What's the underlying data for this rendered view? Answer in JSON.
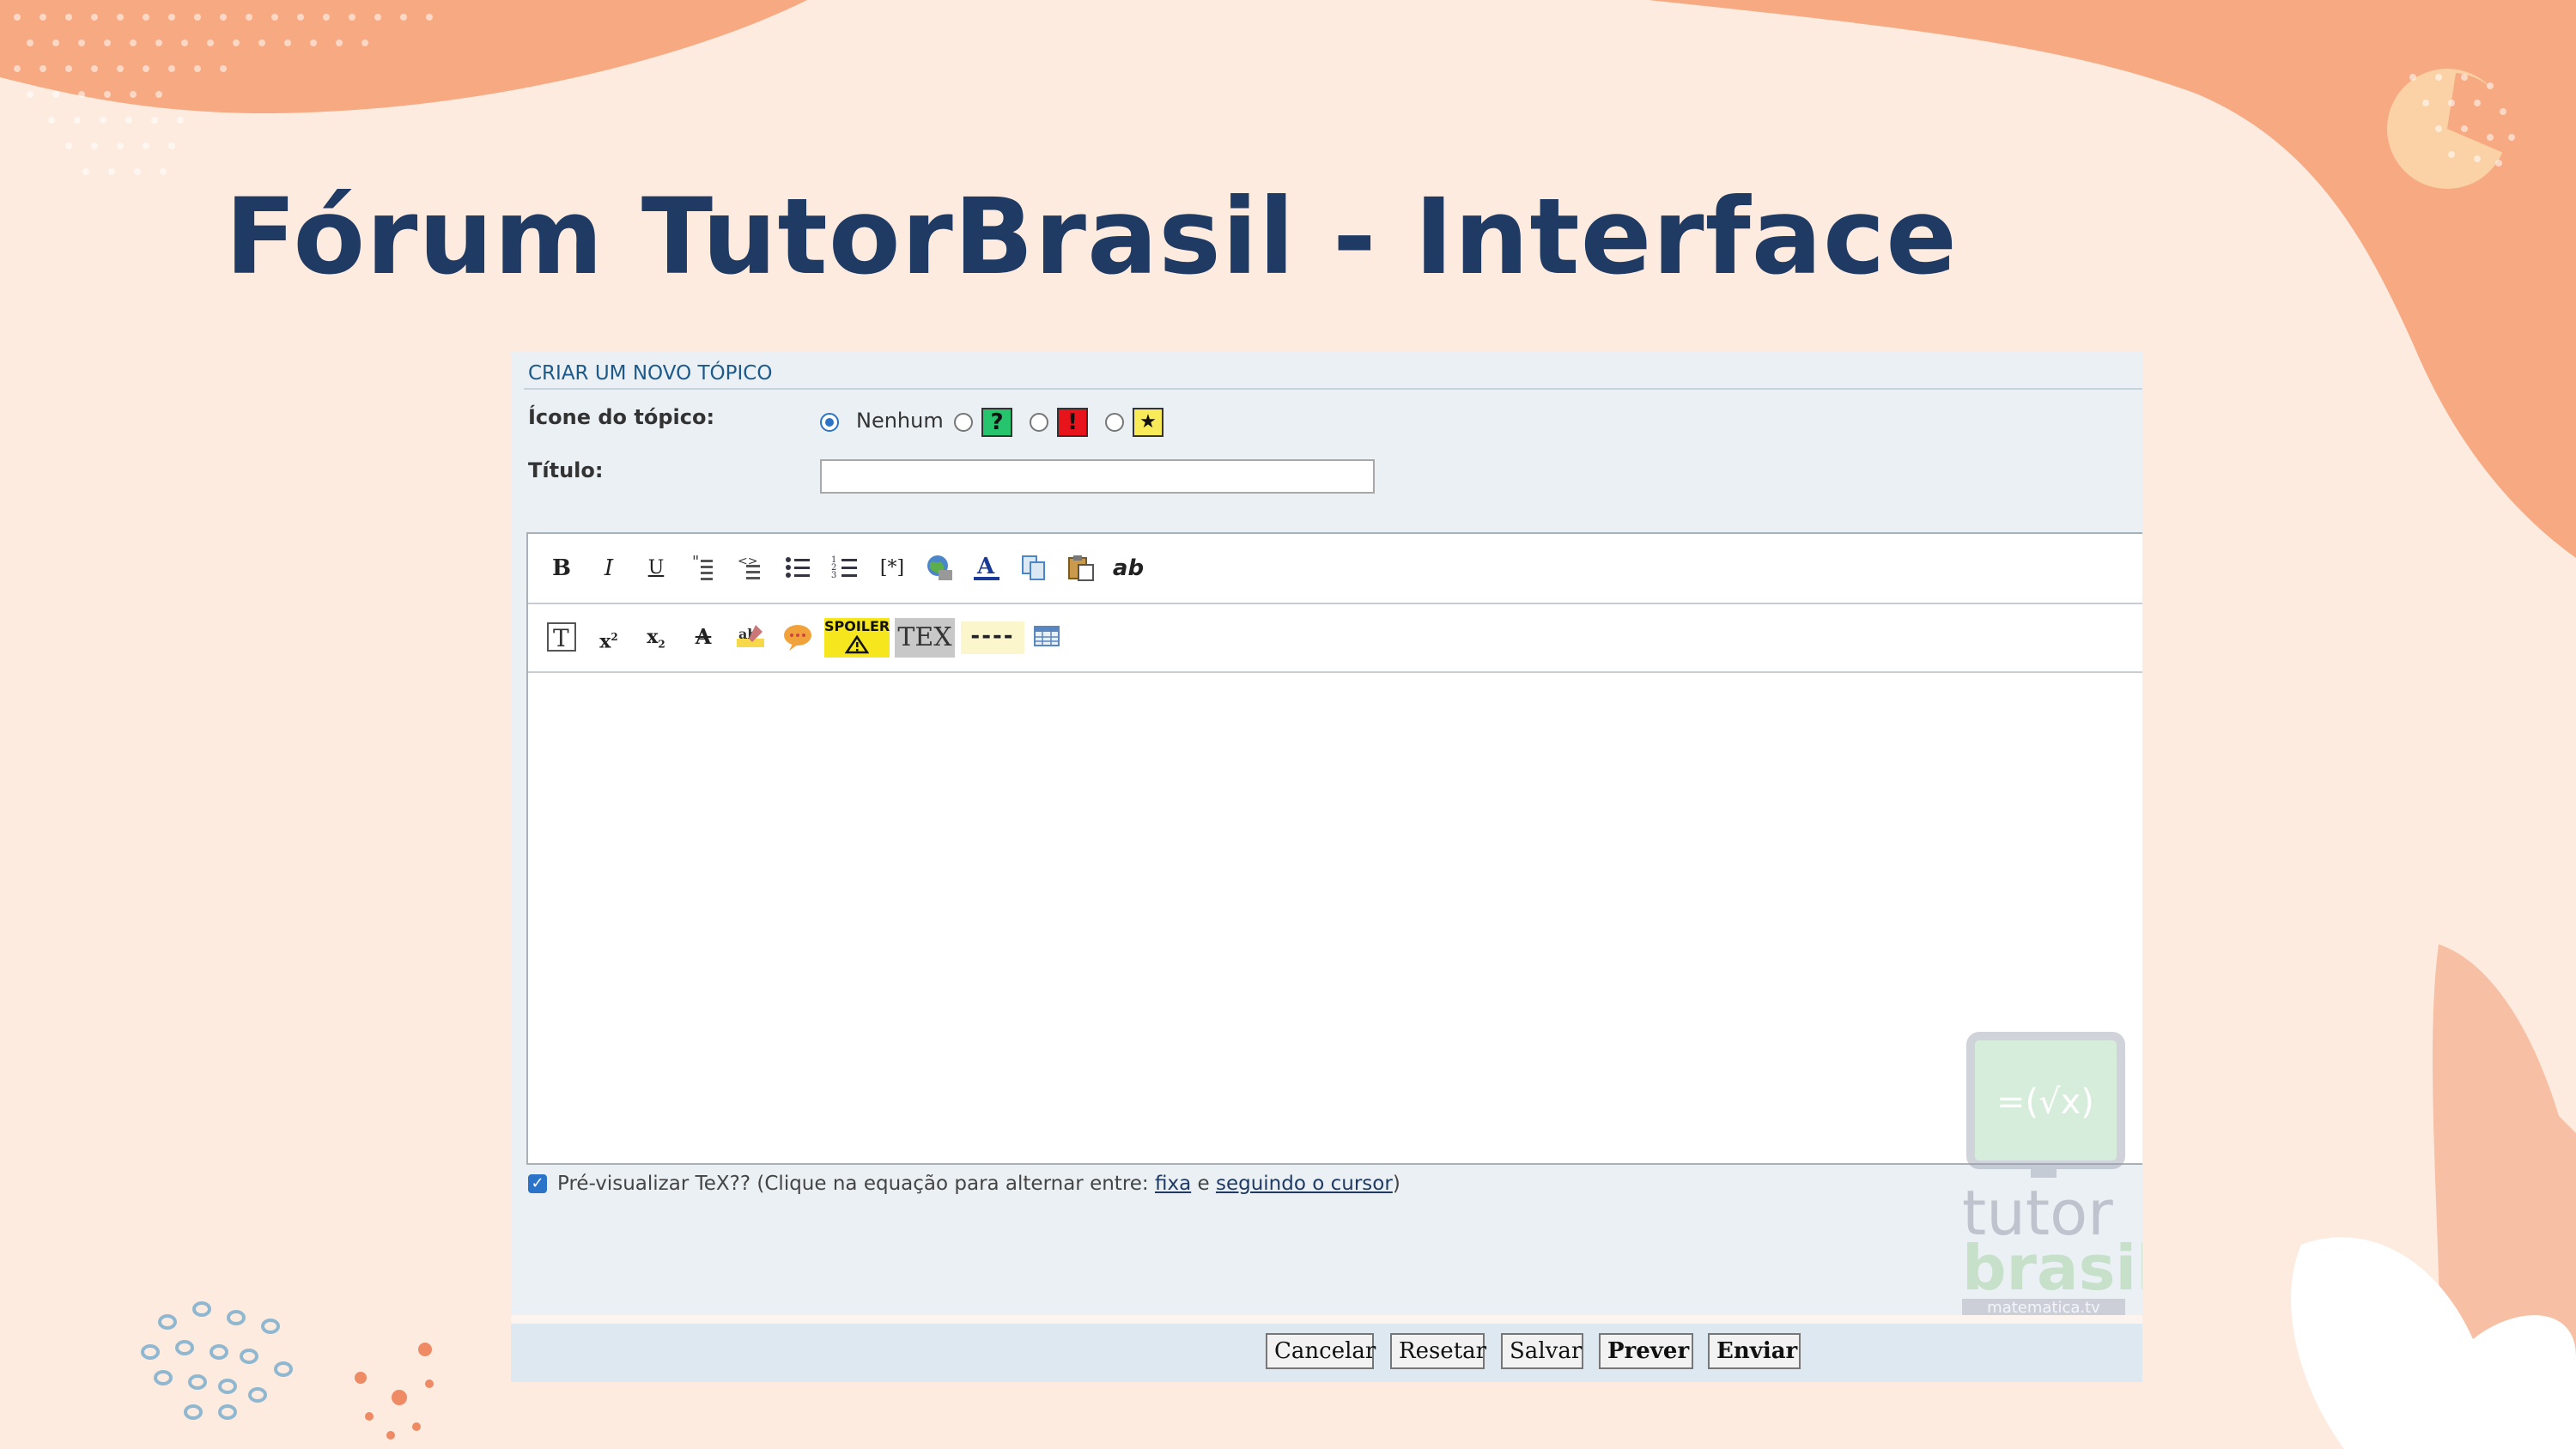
{
  "slide": {
    "title": "Fórum TutorBrasil - Interface"
  },
  "form": {
    "heading": "CRIAR UM NOVO TÓPICO",
    "topic_icon_label": "Ícone do tópico:",
    "topic_icon_options": [
      {
        "label": "Nenhum",
        "selected": true
      },
      {
        "icon": "question-icon",
        "symbol": "?",
        "color": "#27c46e",
        "selected": false
      },
      {
        "icon": "exclamation-icon",
        "symbol": "!",
        "color": "#e8141c",
        "selected": false
      },
      {
        "icon": "star-icon",
        "symbol": "★",
        "color": "#f9ea5a",
        "selected": false
      }
    ],
    "title_label": "Título:",
    "title_value": "",
    "toolbar_row1": [
      "bold-icon",
      "italic-icon",
      "underline-icon",
      "quote-icon",
      "code-icon",
      "bullet-list-icon",
      "numbered-list-icon",
      "list-item-icon",
      "image-icon",
      "font-color-icon",
      "copy-icon",
      "paste-icon",
      "ab-text-icon"
    ],
    "toolbar_row2": [
      "text-icon",
      "superscript-icon",
      "subscript-icon",
      "strikethrough-icon",
      "highlight-icon",
      "speech-bubble-icon",
      "spoiler-icon",
      "tex-icon",
      "horizontal-rule-icon",
      "table-icon"
    ],
    "spoiler_text": "SPOILER",
    "tex_text": "TEX",
    "watermark": {
      "line1": "tutor",
      "line2": "brasil",
      "line3": "matematica.tv"
    },
    "preview": {
      "checked": true,
      "text_before": "Pré-visualizar TeX?? (Clique na equação para alternar entre: ",
      "link_fixed": "fixa",
      "text_middle": " e ",
      "link_cursor": "seguindo o cursor",
      "text_after": ")"
    },
    "buttons": {
      "cancel": "Cancelar",
      "reset": "Resetar",
      "save": "Salvar",
      "preview": "Prever",
      "submit": "Enviar"
    }
  }
}
